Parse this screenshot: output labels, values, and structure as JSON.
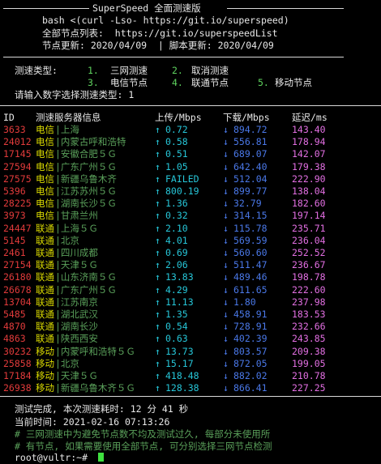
{
  "header": {
    "title": "SuperSpeed 全面测速版",
    "command": "bash <(curl -Lso- https://git.io/superspeed)",
    "node_list": "全部节点列表:  https://git.io/superspeedList",
    "update_line": "节点更新: 2020/04/09  | 脚本更新: 2020/04/09"
  },
  "menu": {
    "label": "测速类型:",
    "options": [
      {
        "num": "1.",
        "label": "三网测速"
      },
      {
        "num": "2.",
        "label": "取消测速"
      },
      {
        "num": "3.",
        "label": "电信节点"
      },
      {
        "num": "4.",
        "label": "联通节点"
      },
      {
        "num": "5.",
        "label": "移动节点"
      }
    ],
    "prompt": "请输入数字选择测速类型: 1"
  },
  "table": {
    "headers": {
      "id": "ID",
      "server": "测速服务器信息",
      "upload": "上传/Mbps",
      "download": "下载/Mbps",
      "latency": "延迟/ms"
    },
    "up_arrow": "↑",
    "down_arrow": "↓",
    "rows": [
      {
        "id": "3633",
        "isp": "电信",
        "loc": "|上海",
        "up": "0.72",
        "down": "894.72",
        "ping": "143.40"
      },
      {
        "id": "24012",
        "isp": "电信",
        "loc": "|内蒙古呼和浩特",
        "up": "0.58",
        "down": "556.81",
        "ping": "178.94"
      },
      {
        "id": "17145",
        "isp": "电信",
        "loc": "|安徽合肥５Ｇ",
        "up": "0.51",
        "down": "689.07",
        "ping": "142.07"
      },
      {
        "id": "27594",
        "isp": "电信",
        "loc": "|广东广州５Ｇ",
        "up": "1.05",
        "down": "642.40",
        "ping": "179.38"
      },
      {
        "id": "27575",
        "isp": "电信",
        "loc": "|新疆乌鲁木齐",
        "up": "FAILED",
        "down": "512.04",
        "ping": "222.90"
      },
      {
        "id": "5396",
        "isp": "电信",
        "loc": "|江苏苏州５Ｇ",
        "up": "800.19",
        "down": "899.77",
        "ping": "138.04"
      },
      {
        "id": "28225",
        "isp": "电信",
        "loc": "|湖南长沙５Ｇ",
        "up": "1.36",
        "down": "32.79",
        "ping": "182.60"
      },
      {
        "id": "3973",
        "isp": "电信",
        "loc": "|甘肃兰州",
        "up": "0.32",
        "down": "314.15",
        "ping": "197.14"
      },
      {
        "id": "24447",
        "isp": "联通",
        "loc": "|上海５Ｇ",
        "up": "2.10",
        "down": "115.78",
        "ping": "235.71"
      },
      {
        "id": "5145",
        "isp": "联通",
        "loc": "|北京",
        "up": "4.01",
        "down": "569.59",
        "ping": "236.04"
      },
      {
        "id": "2461",
        "isp": "联通",
        "loc": "|四川成都",
        "up": "0.69",
        "down": "560.60",
        "ping": "252.52"
      },
      {
        "id": "27154",
        "isp": "联通",
        "loc": "|天津５Ｇ",
        "up": "2.06",
        "down": "511.47",
        "ping": "236.67"
      },
      {
        "id": "26180",
        "isp": "联通",
        "loc": "|山东济南５Ｇ",
        "up": "13.83",
        "down": "489.46",
        "ping": "198.78"
      },
      {
        "id": "26678",
        "isp": "联通",
        "loc": "|广东广州５Ｇ",
        "up": "4.29",
        "down": "611.65",
        "ping": "222.60"
      },
      {
        "id": "13704",
        "isp": "联通",
        "loc": "|江苏南京",
        "up": "11.13",
        "down": "1.80",
        "ping": "237.98"
      },
      {
        "id": "5485",
        "isp": "联通",
        "loc": "|湖北武汉",
        "up": "1.35",
        "down": "458.91",
        "ping": "183.53"
      },
      {
        "id": "4870",
        "isp": "联通",
        "loc": "|湖南长沙",
        "up": "0.54",
        "down": "728.91",
        "ping": "232.66"
      },
      {
        "id": "4863",
        "isp": "联通",
        "loc": "|陕西西安",
        "up": "0.63",
        "down": "402.39",
        "ping": "243.85"
      },
      {
        "id": "30232",
        "isp": "移动",
        "loc": "|内蒙呼和浩特５Ｇ",
        "up": "13.73",
        "down": "803.57",
        "ping": "209.38"
      },
      {
        "id": "25858",
        "isp": "移动",
        "loc": "|北京",
        "up": "15.17",
        "down": "872.05",
        "ping": "199.05"
      },
      {
        "id": "17184",
        "isp": "移动",
        "loc": "|天津５Ｇ",
        "up": "418.48",
        "down": "882.02",
        "ping": "210.78"
      },
      {
        "id": "26938",
        "isp": "移动",
        "loc": "|新疆乌鲁木齐５Ｇ",
        "up": "128.38",
        "down": "866.41",
        "ping": "227.25"
      }
    ]
  },
  "footer": {
    "done": "测试完成, 本次测速耗时: 12 分 41 秒",
    "time": "当前时间: 2021-02-16 07:13:26",
    "note1": "# 三网测速中为避免节点数不均及测试过久, 每部分未使用所",
    "note2": "# 有节点, 如果需要使用全部节点, 可分别选择三网节点检测",
    "prompt": "root@vultr:~#"
  },
  "colors": {
    "background": "#000000",
    "id": "#e23b3b",
    "isp": "#d9d900",
    "location": "#5aa05a",
    "upload": "#26c6d8",
    "download": "#4a78e8",
    "latency": "#e26fe2",
    "menu_number": "#5fd35f"
  }
}
